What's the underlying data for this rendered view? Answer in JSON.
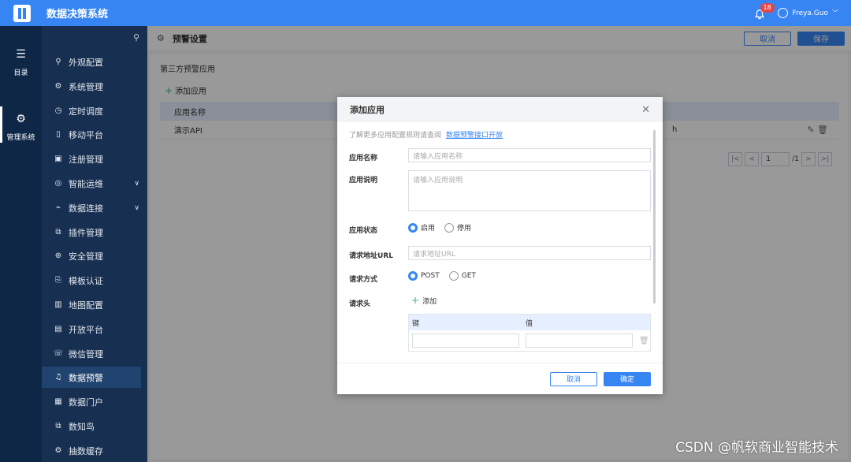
{
  "app": {
    "title": "数据决策系统"
  },
  "header": {
    "notification_count": "18",
    "user_name": "Freya.Guo"
  },
  "rail": [
    {
      "label": "目录",
      "icon": "list-icon"
    },
    {
      "label": "管理系统",
      "icon": "gear-icon"
    }
  ],
  "nav": {
    "items": [
      {
        "label": "外观配置",
        "glyph": "⚲"
      },
      {
        "label": "系统管理",
        "glyph": "⚙"
      },
      {
        "label": "定时调度",
        "glyph": "◷"
      },
      {
        "label": "移动平台",
        "glyph": "▯"
      },
      {
        "label": "注册管理",
        "glyph": "▣"
      },
      {
        "label": "智能运维",
        "glyph": "◎"
      },
      {
        "label": "数据连接",
        "glyph": "⌁"
      },
      {
        "label": "插件管理",
        "glyph": "⧉"
      },
      {
        "label": "安全管理",
        "glyph": "⊕"
      },
      {
        "label": "模板认证",
        "glyph": "⎘"
      },
      {
        "label": "地图配置",
        "glyph": "▥"
      },
      {
        "label": "开放平台",
        "glyph": "▤"
      },
      {
        "label": "微信管理",
        "glyph": "☏"
      },
      {
        "label": "数据预警",
        "glyph": "♫"
      },
      {
        "label": "数据门户",
        "glyph": "▦"
      },
      {
        "label": "数知鸟",
        "glyph": "⧉"
      },
      {
        "label": "抽数缓存",
        "glyph": "⚙"
      }
    ]
  },
  "page": {
    "title": "预警设置",
    "cancel_label": "取消",
    "save_label": "保存",
    "section_title": "第三方预警应用",
    "add_app_label": "添加应用",
    "table": {
      "headers": [
        "应用名称"
      ],
      "rows": [
        {
          "name": "演示API",
          "tail": "h"
        }
      ]
    },
    "pagination": {
      "current_page": "1",
      "total": "/1"
    }
  },
  "modal": {
    "title": "添加应用",
    "hint_text": "了解更多应用配置规则请查阅",
    "hint_link": "数据预警接口开放",
    "fields": {
      "name_label": "应用名称",
      "name_placeholder": "请输入应用名称",
      "desc_label": "应用说明",
      "desc_placeholder": "请输入应用说明",
      "status_label": "应用状态",
      "status_on": "启用",
      "status_off": "停用",
      "url_label": "请求地址URL",
      "url_placeholder": "请求地址URL",
      "method_label": "请求方式",
      "method_post": "POST",
      "method_get": "GET",
      "header_label": "请求头",
      "header_add": "添加",
      "kv_key": "键",
      "kv_value": "值"
    },
    "cancel_label": "取消",
    "ok_label": "确定"
  },
  "watermark": "CSDN @帆软商业智能技术"
}
